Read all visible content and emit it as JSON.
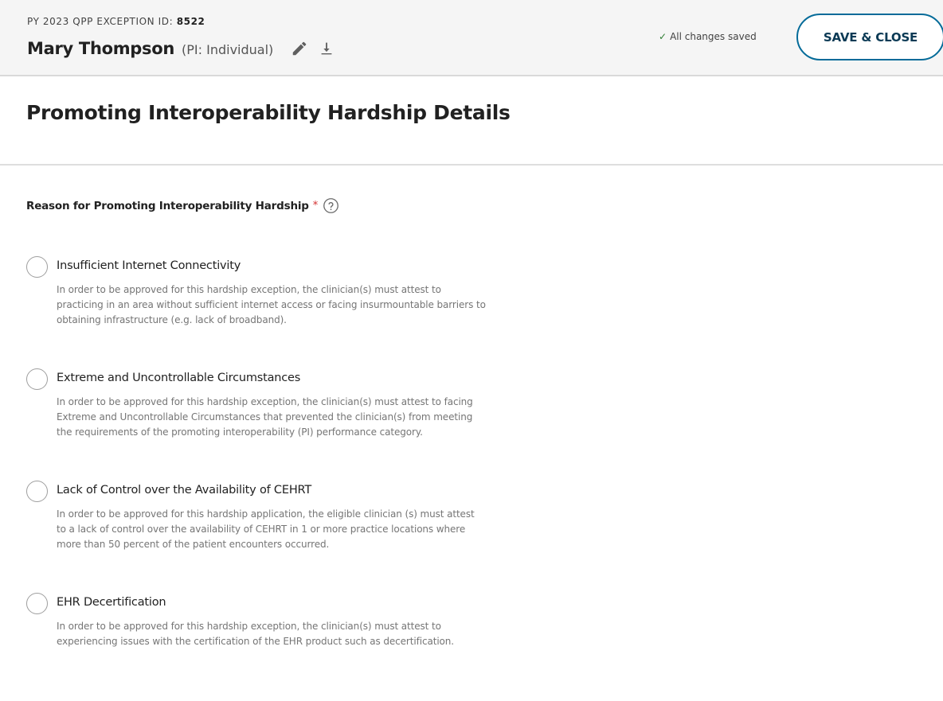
{
  "header": {
    "exception_prefix": "PY 2023 QPP EXCEPTION ID: ",
    "exception_id": "8522",
    "clinician_name": "Mary Thompson",
    "clinician_type": "(PI: Individual)",
    "edit_icon": "pencil-icon",
    "download_icon": "download-icon",
    "save_status": "All changes saved",
    "save_status_icon": "checkmark-icon",
    "save_close_label": "SAVE & CLOSE",
    "accent_color": "#046b99"
  },
  "page": {
    "title": "Promoting Interoperability Hardship Details"
  },
  "question": {
    "label": "Reason for Promoting Interoperability Hardship",
    "required_marker": "*",
    "help_icon": "question-circle-icon"
  },
  "options": [
    {
      "label": "Insufficient Internet Connectivity",
      "description": "In order to be approved for this hardship exception, the clinician(s) must attest to practicing in an area without sufficient internet access or facing insurmountable barriers to obtaining infrastructure (e.g. lack of broadband).",
      "selected": false
    },
    {
      "label": "Extreme and Uncontrollable Circumstances",
      "description": "In order to be approved for this hardship exception, the clinician(s) must attest to facing Extreme and Uncontrollable Circumstances that prevented the clinician(s) from meeting the requirements of the promoting interoperability (PI) performance category.",
      "selected": false
    },
    {
      "label": "Lack of Control over the Availability of CEHRT",
      "description": "In order to be approved for this hardship application, the eligible clinician (s) must attest to a lack of control over the availability of CEHRT in 1 or more practice locations where more than 50 percent of the patient encounters occurred.",
      "selected": false
    },
    {
      "label": "EHR Decertification",
      "description": "In order to be approved for this hardship exception, the clinician(s) must attest to experiencing issues with the certification of the EHR product such as decertification.",
      "selected": false
    }
  ]
}
